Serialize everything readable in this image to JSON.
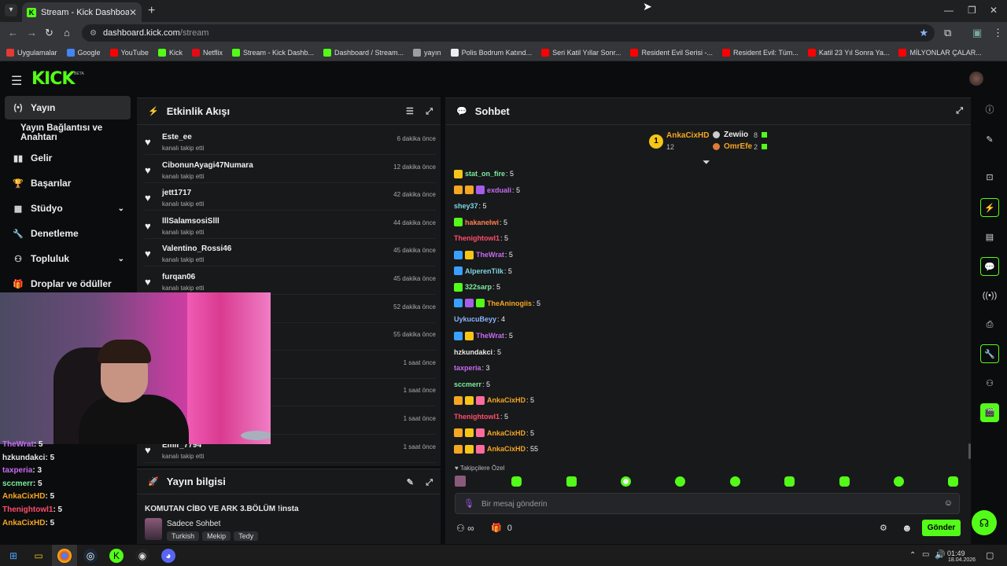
{
  "browser": {
    "tab_title": "Stream - Kick Dashboard",
    "url_host": "dashboard.kick.com",
    "url_path": "/stream",
    "bookmarks": [
      {
        "label": "Uygulamalar",
        "color": "#e53935"
      },
      {
        "label": "Google",
        "color": "#4285f4"
      },
      {
        "label": "YouTube",
        "color": "#ff0000"
      },
      {
        "label": "Kick",
        "color": "#53fc18"
      },
      {
        "label": "Netflix",
        "color": "#e50914"
      },
      {
        "label": "Stream - Kick Dashb...",
        "color": "#53fc18"
      },
      {
        "label": "Dashboard / Stream...",
        "color": "#53fc18"
      },
      {
        "label": "yayın",
        "color": "#9e9e9e"
      },
      {
        "label": "Polis Bodrum Katınd...",
        "color": "#eeeeee"
      },
      {
        "label": "Seri Katil Yıllar Sonr...",
        "color": "#ff0000"
      },
      {
        "label": "Resident Evil Serisi -...",
        "color": "#ff0000"
      },
      {
        "label": "Resident Evil: Tüm...",
        "color": "#ff0000"
      },
      {
        "label": "Katil 23 Yıl Sonra Ya...",
        "color": "#ff0000"
      },
      {
        "label": "MİLYONLAR ÇALAR...",
        "color": "#ff0000"
      }
    ]
  },
  "brand": {
    "logo": "KICK",
    "beta": "BETA",
    "accent": "#53fc18"
  },
  "nav": {
    "items": [
      {
        "label": "Yayın",
        "icon": "broadcast-icon"
      },
      {
        "label": "Yayın Bağlantısı ve Anahtarı",
        "icon": ""
      },
      {
        "label": "Gelir",
        "icon": "chart-icon"
      },
      {
        "label": "Başarılar",
        "icon": "trophy-icon"
      },
      {
        "label": "Stüdyo",
        "icon": "studio-icon"
      },
      {
        "label": "Denetleme",
        "icon": "wrench-icon"
      },
      {
        "label": "Topluluk",
        "icon": "people-icon"
      },
      {
        "label": "Droplar ve ödüller",
        "icon": "gift-icon"
      }
    ]
  },
  "activity": {
    "title": "Etkinlik Akışı",
    "events": [
      {
        "name": "Este_ee",
        "action": "kanalı takip etti",
        "time": "6 dakika önce"
      },
      {
        "name": "CibonunAyagi47Numara",
        "action": "kanalı takip etti",
        "time": "12 dakika önce"
      },
      {
        "name": "jett1717",
        "action": "kanalı takip etti",
        "time": "42 dakika önce"
      },
      {
        "name": "lllSalamsosiSlll",
        "action": "kanalı takip etti",
        "time": "44 dakika önce"
      },
      {
        "name": "Valentino_Rossi46",
        "action": "kanalı takip etti",
        "time": "45 dakika önce"
      },
      {
        "name": "furqan06",
        "action": "kanalı takip etti",
        "time": "45 dakika önce"
      },
      {
        "name": "",
        "action": "",
        "time": "52 dakika önce"
      },
      {
        "name": "",
        "action": "",
        "time": "55 dakika önce"
      },
      {
        "name": "",
        "action": "",
        "time": "1 saat önce"
      },
      {
        "name": "",
        "action": "",
        "time": "1 saat önce"
      },
      {
        "name": "",
        "action": "",
        "time": "1 saat önce"
      },
      {
        "name": "Emir_7794",
        "action": "kanalı takip etti",
        "time": "1 saat önce"
      }
    ]
  },
  "overlay_chat": [
    {
      "name": "TheWrat",
      "value": ": 5",
      "color": "#c56cf0"
    },
    {
      "name": "hzkundakci",
      "value": ": 5",
      "color": "#e8e8e8"
    },
    {
      "name": "taxperia",
      "value": ": 3",
      "color": "#c56cf0"
    },
    {
      "name": "sccmerr",
      "value": ": 5",
      "color": "#7bed9f"
    },
    {
      "name": "AnkaCixHD",
      "value": ": 5",
      "color": "#f5a623"
    },
    {
      "name": "Thenightowl1",
      "value": ": 5",
      "color": "#ff4d6d"
    },
    {
      "name": "AnkaCixHD",
      "value": ": 5",
      "color": "#f5a623"
    }
  ],
  "stream_info": {
    "title": "Yayın bilgisi",
    "stream_title": "KOMUTAN CİBO VE ARK 3.BÖLÜM !insta",
    "category": "Sadece Sohbet",
    "tags": [
      "Turkish",
      "Mekip",
      "Tedy"
    ]
  },
  "chat": {
    "title": "Sohbet",
    "leaderboard": {
      "first": {
        "rank": "1",
        "name": "AnkaCixHD",
        "count": "12"
      },
      "second": {
        "name": "Zewiio",
        "count": "8"
      },
      "third": {
        "name": "OmrEfe",
        "count": "2"
      }
    },
    "messages": [
      {
        "name": "stat_on_fire",
        "value": ": 5",
        "color": "#7bed9f",
        "badges": [
          "#f5c518"
        ]
      },
      {
        "name": "exduali",
        "value": ": 5",
        "color": "#c56cf0",
        "badges": [
          "#f5a623",
          "#f5a623",
          "#a55eea"
        ]
      },
      {
        "name": "shey37",
        "value": ": 5",
        "color": "#7ed6df",
        "badges": []
      },
      {
        "name": "hakanelwi",
        "value": ": 5",
        "color": "#ff7f50",
        "badges": [
          "#53fc18"
        ]
      },
      {
        "name": "Thenightowl1",
        "value": ": 5",
        "color": "#ff4d6d",
        "badges": []
      },
      {
        "name": "TheWrat",
        "value": ": 5",
        "color": "#c56cf0",
        "badges": [
          "#3aa0ff",
          "#f5c518"
        ]
      },
      {
        "name": "AlperenTilk",
        "value": ": 5",
        "color": "#7ed6df",
        "badges": [
          "#3aa0ff"
        ]
      },
      {
        "name": "322sarp",
        "value": ": 5",
        "color": "#7bed9f",
        "badges": [
          "#53fc18"
        ]
      },
      {
        "name": "TheAninogiis",
        "value": ": 5",
        "color": "#f5a623",
        "badges": [
          "#3aa0ff",
          "#a55eea",
          "#53fc18"
        ]
      },
      {
        "name": "UykucuBeyy",
        "value": ": 4",
        "color": "#8ab4f8",
        "badges": []
      },
      {
        "name": "TheWrat",
        "value": ": 5",
        "color": "#c56cf0",
        "badges": [
          "#3aa0ff",
          "#f5c518"
        ]
      },
      {
        "name": "hzkundakci",
        "value": ": 5",
        "color": "#e8e8e8",
        "badges": []
      },
      {
        "name": "taxperia",
        "value": ": 3",
        "color": "#c56cf0",
        "badges": []
      },
      {
        "name": "sccmerr",
        "value": ": 5",
        "color": "#7bed9f",
        "badges": []
      },
      {
        "name": "AnkaCixHD",
        "value": ": 5",
        "color": "#f5a623",
        "badges": [
          "#f5a623",
          "#f5c518",
          "#ff6b9d"
        ]
      },
      {
        "name": "Thenightowl1",
        "value": ": 5",
        "color": "#ff4d6d",
        "badges": []
      },
      {
        "name": "AnkaCixHD",
        "value": ": 5",
        "color": "#f5a623",
        "badges": [
          "#f5a623",
          "#f5c518",
          "#ff6b9d"
        ]
      },
      {
        "name": "AnkaCixHD",
        "value": ": 55",
        "color": "#f5a623",
        "badges": [
          "#f5a623",
          "#f5c518",
          "#ff6b9d"
        ]
      }
    ],
    "followers_only": "Takipçilere Özel",
    "input_placeholder": "Bir mesaj gönderin",
    "viewer_icon": "∞",
    "points": "0",
    "send_label": "Gönder"
  },
  "taskbar": {
    "time": "01:49",
    "date": "18.04.2026"
  }
}
